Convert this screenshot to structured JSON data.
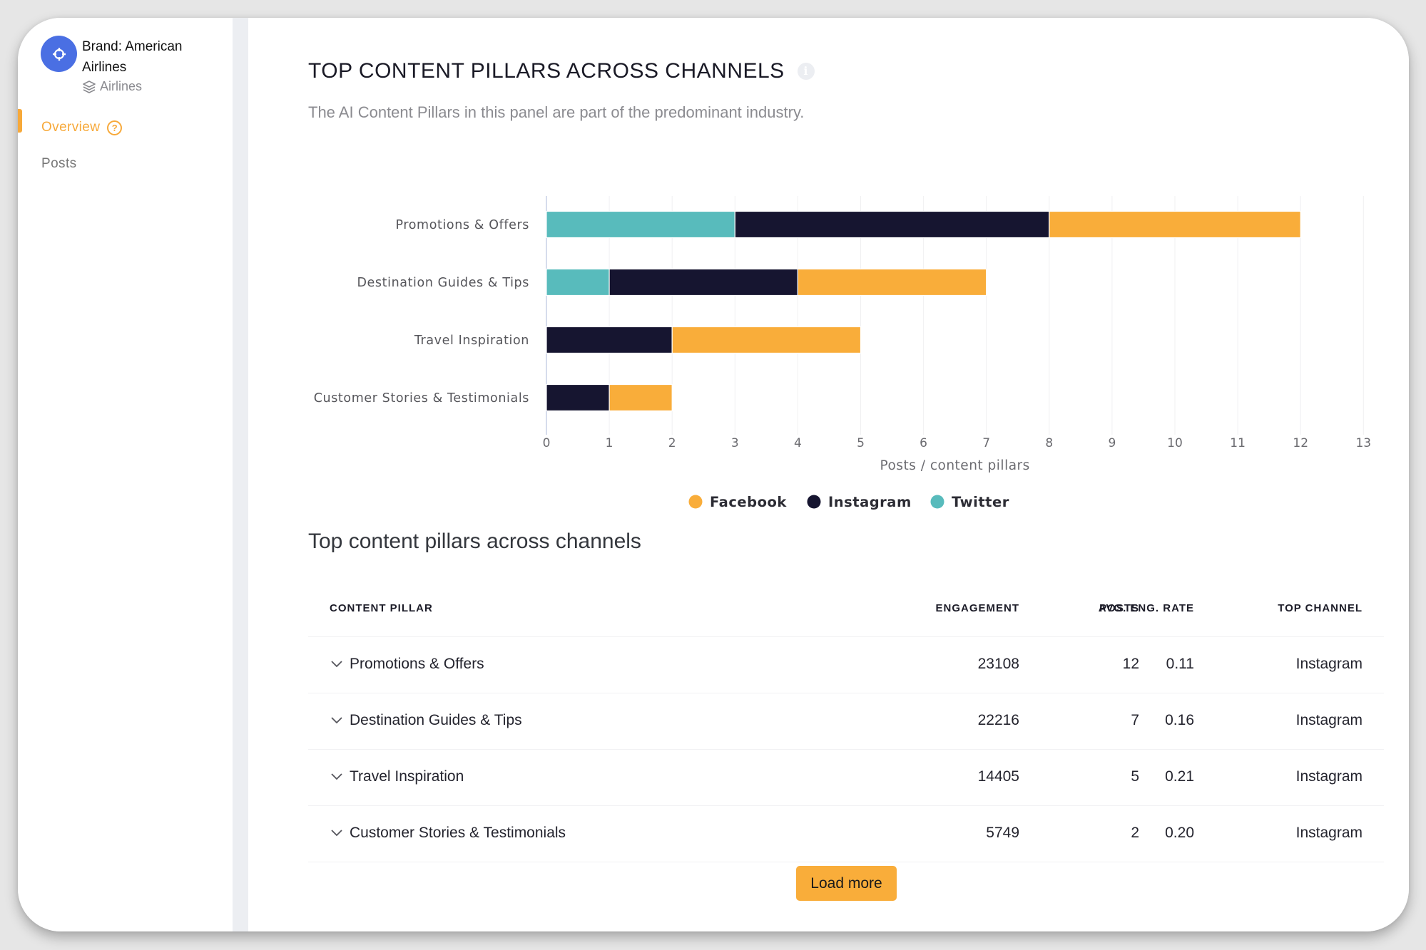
{
  "sidebar": {
    "brand_name": "Brand: American Airlines",
    "industry": "Airlines",
    "brand_icon": "crosshair-icon",
    "industry_icon": "layers-icon",
    "nav": [
      {
        "label": "Overview",
        "active": true,
        "help_icon": "question-circle-icon"
      },
      {
        "label": "Posts",
        "active": false
      }
    ]
  },
  "panel": {
    "title": "TOP CONTENT PILLARS ACROSS CHANNELS",
    "info_icon": "info-icon",
    "subtitle": "The AI Content Pillars in this panel are part of the predominant industry."
  },
  "colors": {
    "accent": "#f7a93a",
    "facebook": "#f9ad3a",
    "instagram": "#161530",
    "twitter": "#58bbbc",
    "brand_avatar": "#4a6fe3"
  },
  "chart_data": {
    "type": "bar",
    "orientation": "horizontal",
    "stacked": true,
    "categories": [
      "Promotions & Offers",
      "Destination Guides & Tips",
      "Travel Inspiration",
      "Customer Stories & Testimonials"
    ],
    "series": [
      {
        "name": "Twitter",
        "color": "#58bbbc",
        "values": [
          3,
          1,
          0,
          0
        ]
      },
      {
        "name": "Instagram",
        "color": "#161530",
        "values": [
          5,
          3,
          2,
          1
        ]
      },
      {
        "name": "Facebook",
        "color": "#f9ad3a",
        "values": [
          4,
          3,
          3,
          1
        ]
      }
    ],
    "legend_order": [
      "Facebook",
      "Instagram",
      "Twitter"
    ],
    "legend": "bottom",
    "xlabel": "Posts / content pillars",
    "ylabel": "",
    "xlim": [
      0,
      13
    ],
    "xticks": [
      "0",
      "1",
      "2",
      "3",
      "4",
      "5",
      "6",
      "7",
      "8",
      "9",
      "10",
      "11",
      "12",
      "13"
    ],
    "grid": true
  },
  "table": {
    "title": "Top content pillars across channels",
    "columns": [
      "CONTENT PILLAR",
      "POSTS",
      "ENGAGEMENT",
      "AVG. ENG. RATE",
      "TOP CHANNEL"
    ],
    "rows": [
      {
        "pillar": "Promotions & Offers",
        "posts": "12",
        "engagement": "23108",
        "rate": "0.11",
        "top_channel": "Instagram"
      },
      {
        "pillar": "Destination Guides & Tips",
        "posts": "7",
        "engagement": "22216",
        "rate": "0.16",
        "top_channel": "Instagram"
      },
      {
        "pillar": "Travel Inspiration",
        "posts": "5",
        "engagement": "14405",
        "rate": "0.21",
        "top_channel": "Instagram"
      },
      {
        "pillar": "Customer Stories & Testimonials",
        "posts": "2",
        "engagement": "5749",
        "rate": "0.20",
        "top_channel": "Instagram"
      }
    ],
    "load_more_label": "Load more"
  }
}
